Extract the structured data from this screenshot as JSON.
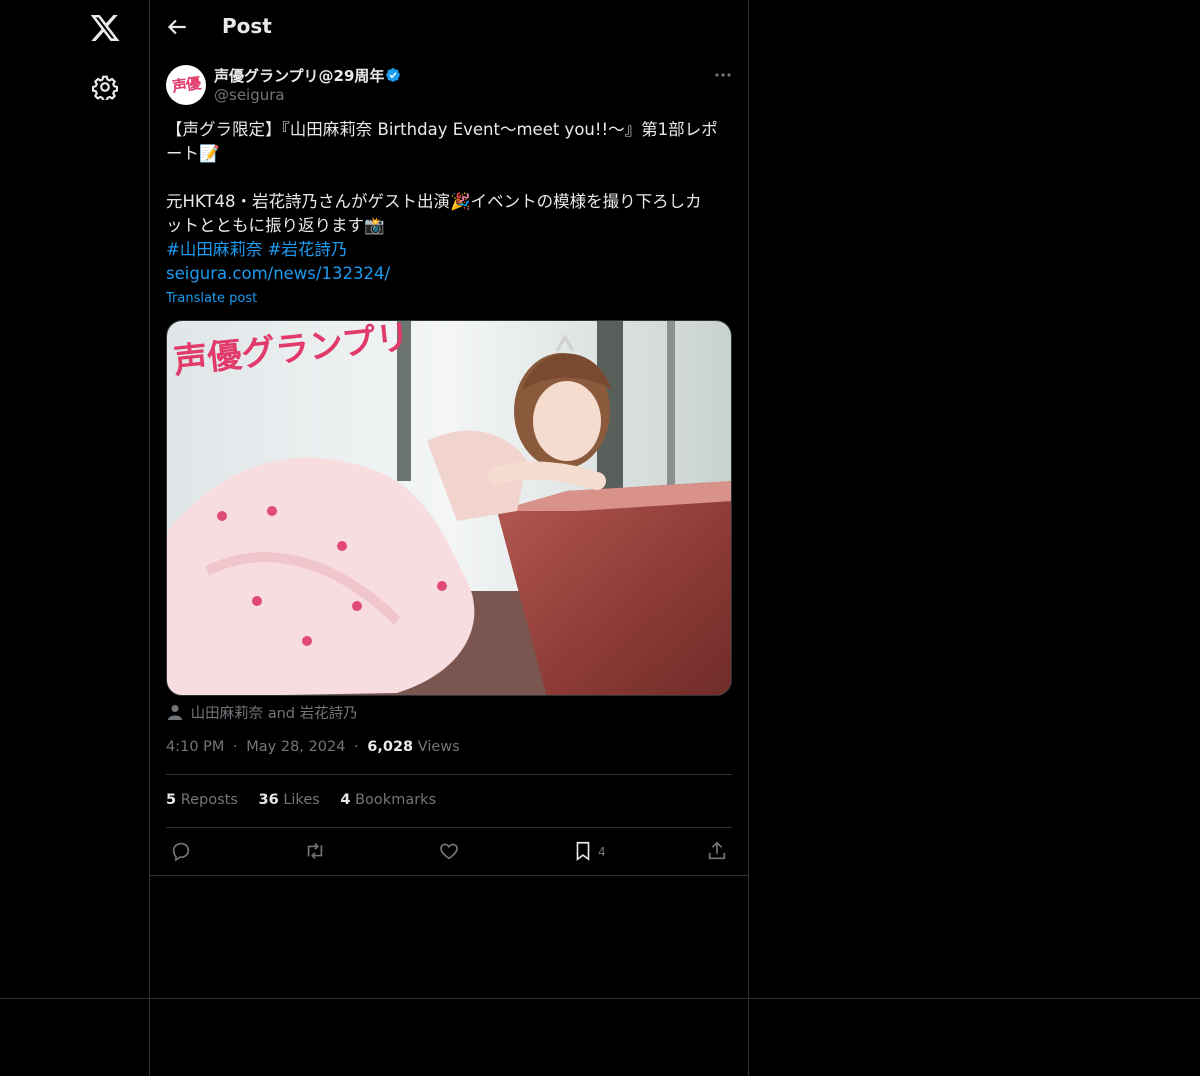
{
  "header": {
    "title": "Post"
  },
  "author": {
    "name": "声優グランプリ@29周年",
    "handle": "@seigura",
    "avatar_text": "声優",
    "verified_color": "#1d9bf0"
  },
  "tweet": {
    "line1": "【声グラ限定】『山田麻莉奈 Birthday Event〜meet you!!〜』第1部レポ",
    "line2": "ート📝",
    "line3": "元HKT48・岩花詩乃さんがゲスト出演🎉イベントの模様を撮り下ろしカ",
    "line4": "ットとともに振り返ります📸",
    "hashtag1": "#山田麻莉奈",
    "hashtag2": "#岩花詩乃",
    "url": "seigura.com/news/132324/",
    "translate": "Translate post"
  },
  "media": {
    "watermark": "声優グランプリ"
  },
  "tagged": "山田麻莉奈 and 岩花詩乃",
  "meta": {
    "time": "4:10 PM",
    "date": "May 28, 2024",
    "views_count": "6,028",
    "views_label": "Views",
    "separator": "·"
  },
  "stats": {
    "reposts_count": "5",
    "reposts_label": "Reposts",
    "likes_count": "36",
    "likes_label": "Likes",
    "bookmarks_count": "4",
    "bookmarks_label": "Bookmarks"
  },
  "actions": {
    "bookmark_count": "4"
  },
  "colors": {
    "background": "#000000",
    "border": "#2f3336",
    "text_primary": "#e7e9ea",
    "text_secondary": "#71767b",
    "accent": "#1d9bf0"
  },
  "icons": [
    "x-logo-icon",
    "gear-icon",
    "back-arrow-icon",
    "verified-icon",
    "more-icon",
    "person-icon",
    "reply-icon",
    "repost-icon",
    "like-icon",
    "bookmark-icon",
    "share-icon"
  ]
}
